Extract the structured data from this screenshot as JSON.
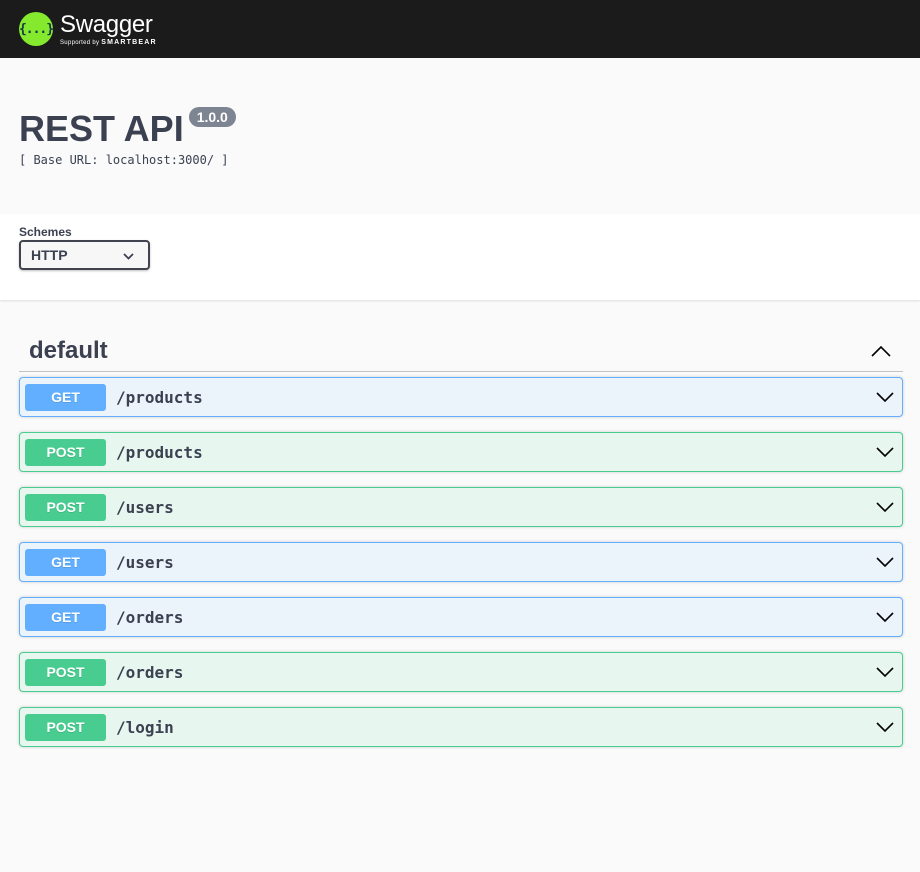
{
  "topbar": {
    "logo_glyph": "{...}",
    "brand": "Swagger",
    "tagline_prefix": "Supported by",
    "tagline_company": "SMARTBEAR",
    "colors": {
      "background": "#1b1b1b",
      "logo": "#85ea2d"
    }
  },
  "info": {
    "title": "REST API",
    "version": "1.0.0",
    "base_url": "[ Base URL: localhost:3000/ ]"
  },
  "schemes": {
    "label": "Schemes",
    "selected": "HTTP"
  },
  "tag": {
    "name": "default",
    "toggle_icon": "chevron-up-icon"
  },
  "operations": [
    {
      "method": "GET",
      "path": "/products"
    },
    {
      "method": "POST",
      "path": "/products"
    },
    {
      "method": "POST",
      "path": "/users"
    },
    {
      "method": "GET",
      "path": "/users"
    },
    {
      "method": "GET",
      "path": "/orders"
    },
    {
      "method": "POST",
      "path": "/orders"
    },
    {
      "method": "POST",
      "path": "/login"
    }
  ],
  "colors": {
    "get": "#61affe",
    "post": "#49cc90",
    "text": "#3b4151"
  }
}
